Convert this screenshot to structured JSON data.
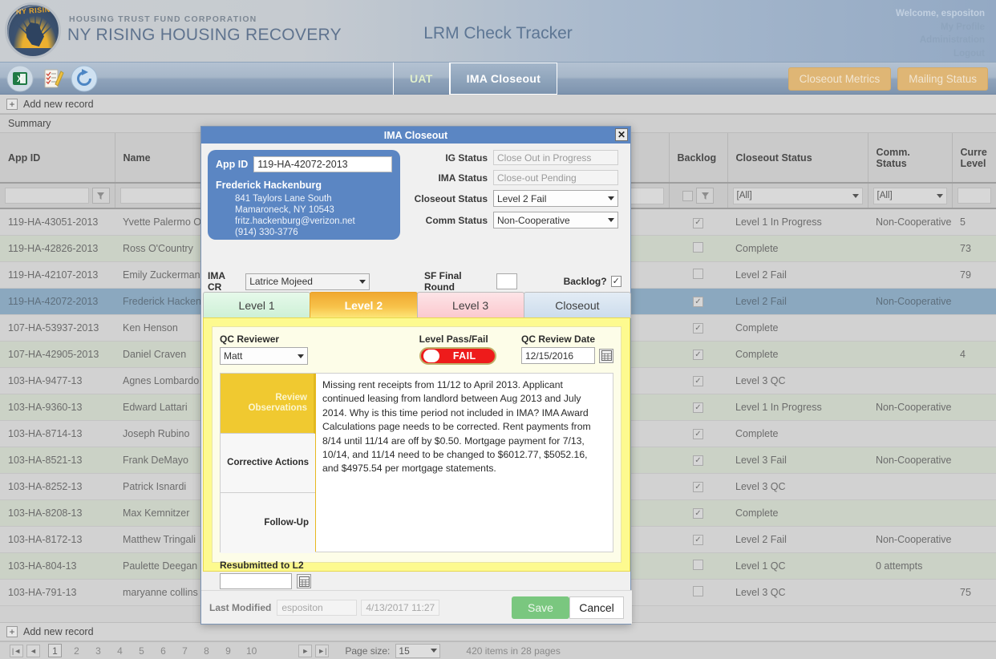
{
  "header": {
    "brand_sub": "HOUSING TRUST FUND CORPORATION",
    "brand_main": "NY RISING HOUSING RECOVERY",
    "logo_text": "NY RISING",
    "app_title": "LRM Check Tracker",
    "welcome": "Welcome, espositon",
    "links": [
      "My Profile",
      "Administration",
      "Logout"
    ]
  },
  "navbar": {
    "icons": [
      "excel-export-icon",
      "notes-checklist-icon",
      "refresh-icon"
    ],
    "tabs": [
      {
        "label": "UAT",
        "active": false
      },
      {
        "label": "IMA Closeout",
        "active": true
      }
    ],
    "buttons": [
      "Closeout Metrics",
      "Mailing Status"
    ]
  },
  "addbar": {
    "label": "Add new record"
  },
  "grid": {
    "summary_label": "Summary",
    "columns": [
      "App ID",
      "Name",
      "",
      "Backlog",
      "Closeout Status",
      "Comm. Status",
      "Curre\nLevel"
    ],
    "filters": {
      "app_id": "",
      "name": "",
      "hidden_col": "",
      "backlog_checkbox": false,
      "closeout_status": "[All]",
      "comm_status": "[All]",
      "current_level": ""
    },
    "rows": [
      {
        "app_id": "119-HA-43051-2013",
        "name": "Yvette Palermo Or",
        "backlog": true,
        "closeout_status": "Level 1 In Progress",
        "comm_status": "Non-Cooperative",
        "level": "5",
        "style": "r-odd"
      },
      {
        "app_id": "119-HA-42826-2013",
        "name": "Ross O'Country",
        "backlog": false,
        "closeout_status": "Complete",
        "comm_status": "",
        "level": "73",
        "style": "r-even"
      },
      {
        "app_id": "119-HA-42107-2013",
        "name": "Emily Zuckerman",
        "backlog": false,
        "closeout_status": "Level 2 Fail",
        "comm_status": "",
        "level": "79",
        "style": "r-odd"
      },
      {
        "app_id": "119-HA-42072-2013",
        "name": "Frederick Hackenb",
        "backlog": true,
        "closeout_status": "Level 2 Fail",
        "comm_status": "Non-Cooperative",
        "level": "",
        "style": "r-sel"
      },
      {
        "app_id": "107-HA-53937-2013",
        "name": "Ken Henson",
        "backlog": true,
        "closeout_status": "Complete",
        "comm_status": "",
        "level": "",
        "style": "r-odd"
      },
      {
        "app_id": "107-HA-42905-2013",
        "name": "Daniel Craven",
        "backlog": true,
        "closeout_status": "Complete",
        "comm_status": "",
        "level": "4",
        "style": "r-even"
      },
      {
        "app_id": "103-HA-9477-13",
        "name": "Agnes Lombardo",
        "backlog": true,
        "closeout_status": "Level 3 QC",
        "comm_status": "",
        "level": "",
        "style": "r-odd"
      },
      {
        "app_id": "103-HA-9360-13",
        "name": "Edward Lattari",
        "backlog": true,
        "closeout_status": "Level 1 In Progress",
        "comm_status": "Non-Cooperative",
        "level": "",
        "style": "r-even"
      },
      {
        "app_id": "103-HA-8714-13",
        "name": "Joseph Rubino",
        "backlog": true,
        "closeout_status": "Complete",
        "comm_status": "",
        "level": "",
        "style": "r-odd"
      },
      {
        "app_id": "103-HA-8521-13",
        "name": "Frank DeMayo",
        "backlog": true,
        "closeout_status": "Level 3 Fail",
        "comm_status": "Non-Cooperative",
        "level": "",
        "style": "r-even"
      },
      {
        "app_id": "103-HA-8252-13",
        "name": "Patrick Isnardi",
        "backlog": true,
        "closeout_status": "Level 3 QC",
        "comm_status": "",
        "level": "",
        "style": "r-odd"
      },
      {
        "app_id": "103-HA-8208-13",
        "name": "Max Kemnitzer",
        "backlog": true,
        "closeout_status": "Complete",
        "comm_status": "",
        "level": "",
        "style": "r-even"
      },
      {
        "app_id": "103-HA-8172-13",
        "name": "Matthew Tringali",
        "backlog": true,
        "closeout_status": "Level 2 Fail",
        "comm_status": "Non-Cooperative",
        "level": "",
        "style": "r-odd"
      },
      {
        "app_id": "103-HA-804-13",
        "name": "Paulette Deegan",
        "backlog": false,
        "closeout_status": "Level 1 QC",
        "comm_status": "0 attempts",
        "level": "",
        "style": "r-even"
      },
      {
        "app_id": "103-HA-791-13",
        "name": "maryanne collins",
        "backlog": false,
        "closeout_status": "Level 3 QC",
        "comm_status": "",
        "level": "75",
        "style": "r-odd"
      }
    ]
  },
  "pager": {
    "pages": [
      "1",
      "2",
      "3",
      "4",
      "5",
      "6",
      "7",
      "8",
      "9",
      "10"
    ],
    "current_page": "1",
    "page_size_label": "Page size:",
    "page_size": "15",
    "items_text": "420 items in 28 pages"
  },
  "modal": {
    "title": "IMA Closeout",
    "close_label": "✕",
    "app_id_label": "App ID",
    "app_id_value": "119-HA-42072-2013",
    "applicant_name": "Frederick Hackenburg",
    "address_line1": "841 Taylors Lane South",
    "address_line2": "Mamaroneck, NY 10543",
    "email": "fritz.hackenburg@verizon.net",
    "phone": "(914) 330-3776",
    "fields": {
      "ig_status_label": "IG Status",
      "ig_status_value": "Close Out in Progress",
      "ima_status_label": "IMA Status",
      "ima_status_value": "Close-out Pending",
      "closeout_status_label": "Closeout Status",
      "closeout_status_value": "Level 2 Fail",
      "comm_status_label": "Comm Status",
      "comm_status_value": "Non-Cooperative",
      "ima_cr_label": "IMA CR",
      "ima_cr_value": "Latrice Mojeed",
      "sf_final_round_label": "SF Final Round",
      "sf_final_round_value": "",
      "backlog_label": "Backlog?",
      "backlog_checked": true
    },
    "level_tabs": [
      {
        "label": "Level 1",
        "active": false
      },
      {
        "label": "Level 2",
        "active": true
      },
      {
        "label": "Level 3",
        "active": false
      },
      {
        "label": "Closeout",
        "active": false
      }
    ],
    "level2": {
      "qc_reviewer_label": "QC Reviewer",
      "qc_reviewer_value": "Matt",
      "pass_fail_label": "Level Pass/Fail",
      "pass_fail_value": "FAIL",
      "qc_review_date_label": "QC Review Date",
      "qc_review_date_value": "12/15/2016",
      "review_observations_label": "Review Observations",
      "review_observations_value": "Missing rent receipts from 11/12 to April 2013. Applicant continued leasing from landlord between Aug 2013 and July 2014. Why is this time period not included in IMA? IMA Award Calculations page needs to be corrected. Rent payments from 8/14 until 11/14 are off by $0.50. Mortgage payment for 7/13, 10/14, and 11/14 need to be changed to $6012.77, $5052.16, and $4975.54 per mortgage statements.",
      "corrective_actions_label": "Corrective Actions",
      "corrective_actions_value": "",
      "follow_up_label": "Follow-Up",
      "follow_up_value": "",
      "resubmitted_label": "Resubmitted to L2",
      "resubmitted_value": ""
    },
    "footer": {
      "last_modified_label": "Last Modified",
      "last_modified_user": "espositon",
      "last_modified_date": "4/13/2017 11:27",
      "save_label": "Save",
      "cancel_label": "Cancel"
    }
  },
  "colors": {
    "brand_blue": "#5b86c3",
    "accent_orange": "#f0a830",
    "fail_red": "#ee1b1b",
    "save_green": "#7ac77f",
    "nav_gold": "#dfb675"
  }
}
